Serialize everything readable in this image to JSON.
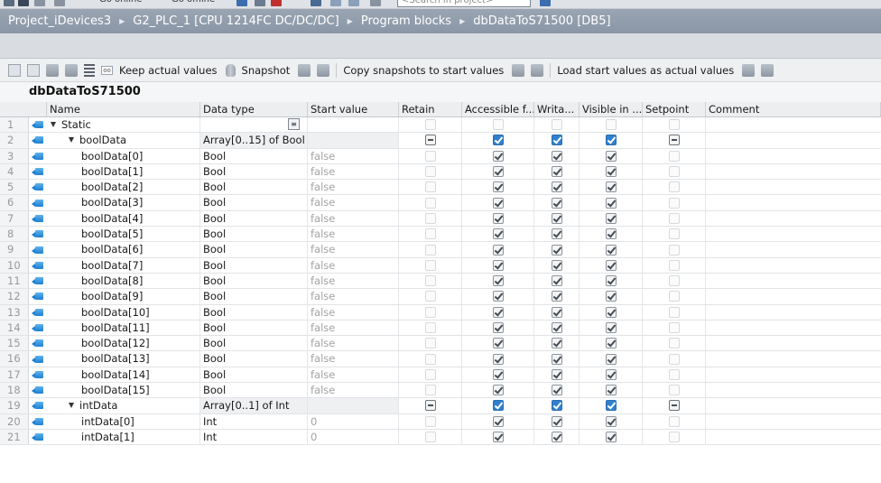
{
  "top_toolbar": {
    "go_online": "Go online",
    "go_offline": "Go offline",
    "search_placeholder": "<Search in project>"
  },
  "breadcrumb": [
    "Project_iDevices3",
    "G2_PLC_1 [CPU 1214FC DC/DC/DC]",
    "Program blocks",
    "dbDataToS71500 [DB5]"
  ],
  "toolbar": {
    "keep_actual": "Keep actual values",
    "snapshot": "Snapshot",
    "copy_snapshots": "Copy snapshots to start values",
    "load_start": "Load start values as actual values"
  },
  "block_title": "dbDataToS71500",
  "columns": {
    "name": "Name",
    "data_type": "Data type",
    "start_value": "Start value",
    "retain": "Retain",
    "accessible": "Accessible f...",
    "writable": "Writa...",
    "visible": "Visible in ...",
    "setpoint": "Setpoint",
    "comment": "Comment"
  },
  "rows": [
    {
      "n": "1",
      "name": "Static",
      "type": "",
      "start": "",
      "kind": "section"
    },
    {
      "n": "2",
      "name": "boolData",
      "type": "Array[0..15] of Bool",
      "start": "",
      "kind": "array"
    },
    {
      "n": "3",
      "name": "boolData[0]",
      "type": "Bool",
      "start": "false",
      "kind": "elem"
    },
    {
      "n": "4",
      "name": "boolData[1]",
      "type": "Bool",
      "start": "false",
      "kind": "elem"
    },
    {
      "n": "5",
      "name": "boolData[2]",
      "type": "Bool",
      "start": "false",
      "kind": "elem"
    },
    {
      "n": "6",
      "name": "boolData[3]",
      "type": "Bool",
      "start": "false",
      "kind": "elem"
    },
    {
      "n": "7",
      "name": "boolData[4]",
      "type": "Bool",
      "start": "false",
      "kind": "elem"
    },
    {
      "n": "8",
      "name": "boolData[5]",
      "type": "Bool",
      "start": "false",
      "kind": "elem"
    },
    {
      "n": "9",
      "name": "boolData[6]",
      "type": "Bool",
      "start": "false",
      "kind": "elem"
    },
    {
      "n": "10",
      "name": "boolData[7]",
      "type": "Bool",
      "start": "false",
      "kind": "elem"
    },
    {
      "n": "11",
      "name": "boolData[8]",
      "type": "Bool",
      "start": "false",
      "kind": "elem"
    },
    {
      "n": "12",
      "name": "boolData[9]",
      "type": "Bool",
      "start": "false",
      "kind": "elem"
    },
    {
      "n": "13",
      "name": "boolData[10]",
      "type": "Bool",
      "start": "false",
      "kind": "elem"
    },
    {
      "n": "14",
      "name": "boolData[11]",
      "type": "Bool",
      "start": "false",
      "kind": "elem"
    },
    {
      "n": "15",
      "name": "boolData[12]",
      "type": "Bool",
      "start": "false",
      "kind": "elem"
    },
    {
      "n": "16",
      "name": "boolData[13]",
      "type": "Bool",
      "start": "false",
      "kind": "elem"
    },
    {
      "n": "17",
      "name": "boolData[14]",
      "type": "Bool",
      "start": "false",
      "kind": "elem"
    },
    {
      "n": "18",
      "name": "boolData[15]",
      "type": "Bool",
      "start": "false",
      "kind": "elem"
    },
    {
      "n": "19",
      "name": "intData",
      "type": "Array[0..1] of Int",
      "start": "",
      "kind": "array"
    },
    {
      "n": "20",
      "name": "intData[0]",
      "type": "Int",
      "start": "0",
      "kind": "elem"
    },
    {
      "n": "21",
      "name": "intData[1]",
      "type": "Int",
      "start": "0",
      "kind": "elem"
    }
  ]
}
